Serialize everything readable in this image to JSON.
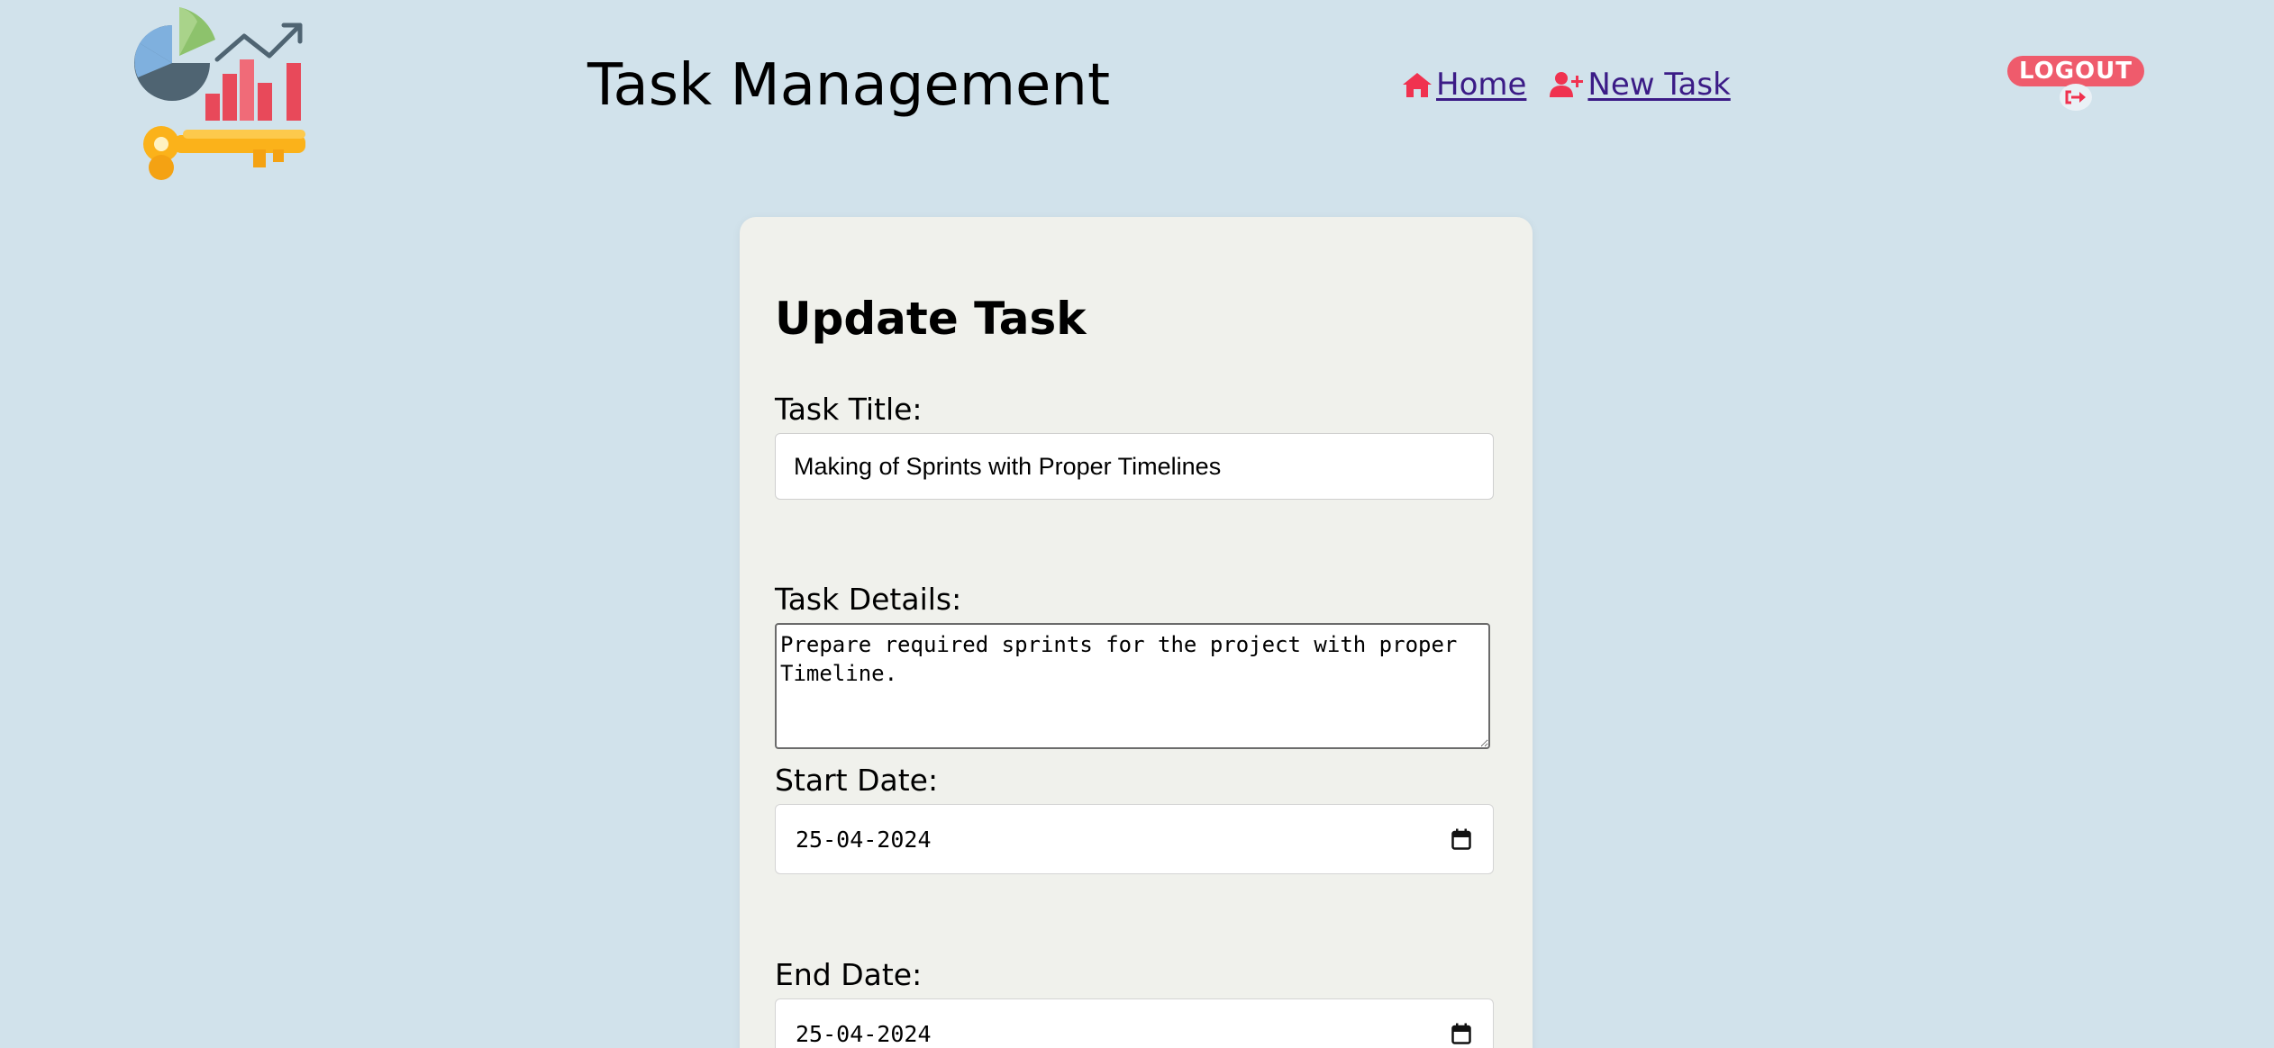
{
  "header": {
    "title": "Task Management",
    "logo_icon": "analytics-key-logo-icon"
  },
  "nav": {
    "home": {
      "label": "Home",
      "icon": "home-icon"
    },
    "new_task": {
      "label": " New Task",
      "icon": "user-plus-icon"
    }
  },
  "logout": {
    "label": "LOGOUT",
    "icon": "sign-out-icon"
  },
  "form": {
    "heading": "Update Task",
    "title_label": "Task Title:",
    "title_value": "Making of Sprints with Proper Timelines",
    "details_label": "Task Details:",
    "details_value": "Prepare required sprints for the project with proper Timeline.",
    "start_label": "Start Date:",
    "start_value": "25-04-2024",
    "end_label": "End Date:",
    "end_value": "25-04-2024"
  },
  "colors": {
    "page_background": "#d1e2eb",
    "card_background": "#f0f1ec",
    "accent_red": "#f0324f",
    "link_color": "#3b1b86",
    "logout_pill": "#ef5b6c"
  }
}
